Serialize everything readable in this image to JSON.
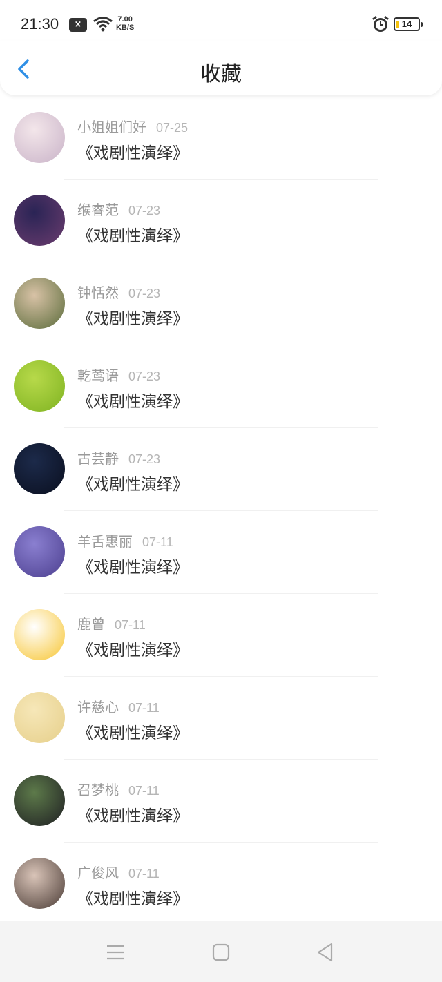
{
  "status": {
    "time": "21:30",
    "notif_icon": "×",
    "speed_value": "7.00",
    "speed_unit": "KB/S",
    "battery": "14"
  },
  "header": {
    "title": "收藏",
    "back_icon": "chevron-left-icon"
  },
  "items": [
    {
      "name": "小姐姐们好",
      "date": "07-25",
      "title": "《戏剧性演绎》",
      "avatar_colors": [
        "#f3e6ea",
        "#c9b3c8"
      ]
    },
    {
      "name": "缑睿范",
      "date": "07-23",
      "title": "《戏剧性演绎》",
      "avatar_colors": [
        "#2a2455",
        "#6b3c6e"
      ]
    },
    {
      "name": "钟恬然",
      "date": "07-23",
      "title": "《戏剧性演绎》",
      "avatar_colors": [
        "#d8c2a6",
        "#5a6b3a"
      ]
    },
    {
      "name": "乾莺语",
      "date": "07-23",
      "title": "《戏剧性演绎》",
      "avatar_colors": [
        "#b7d94a",
        "#7fb321"
      ]
    },
    {
      "name": "古芸静",
      "date": "07-23",
      "title": "《戏剧性演绎》",
      "avatar_colors": [
        "#1c2a4a",
        "#0a0f1f"
      ]
    },
    {
      "name": "羊舌惠丽",
      "date": "07-11",
      "title": "《戏剧性演绎》",
      "avatar_colors": [
        "#8a7fd0",
        "#4c3f8f"
      ]
    },
    {
      "name": "鹿曾",
      "date": "07-11",
      "title": "《戏剧性演绎》",
      "avatar_colors": [
        "#ffffff",
        "#f7c531"
      ]
    },
    {
      "name": "许慈心",
      "date": "07-11",
      "title": "《戏剧性演绎》",
      "avatar_colors": [
        "#f6e7b8",
        "#e6cf8a"
      ]
    },
    {
      "name": "召梦桃",
      "date": "07-11",
      "title": "《戏剧性演绎》",
      "avatar_colors": [
        "#5d7a4a",
        "#1e1e22"
      ]
    },
    {
      "name": "广俊风",
      "date": "07-11",
      "title": "《戏剧性演绎》",
      "avatar_colors": [
        "#d9c4b8",
        "#4a3b35"
      ]
    }
  ],
  "nav": {
    "menu_icon": "menu-icon",
    "home_icon": "square-home-icon",
    "back_icon": "triangle-back-icon"
  },
  "colors": {
    "accent": "#2f8fe6",
    "name_text": "#9a9a9a",
    "title_text": "#333333"
  }
}
